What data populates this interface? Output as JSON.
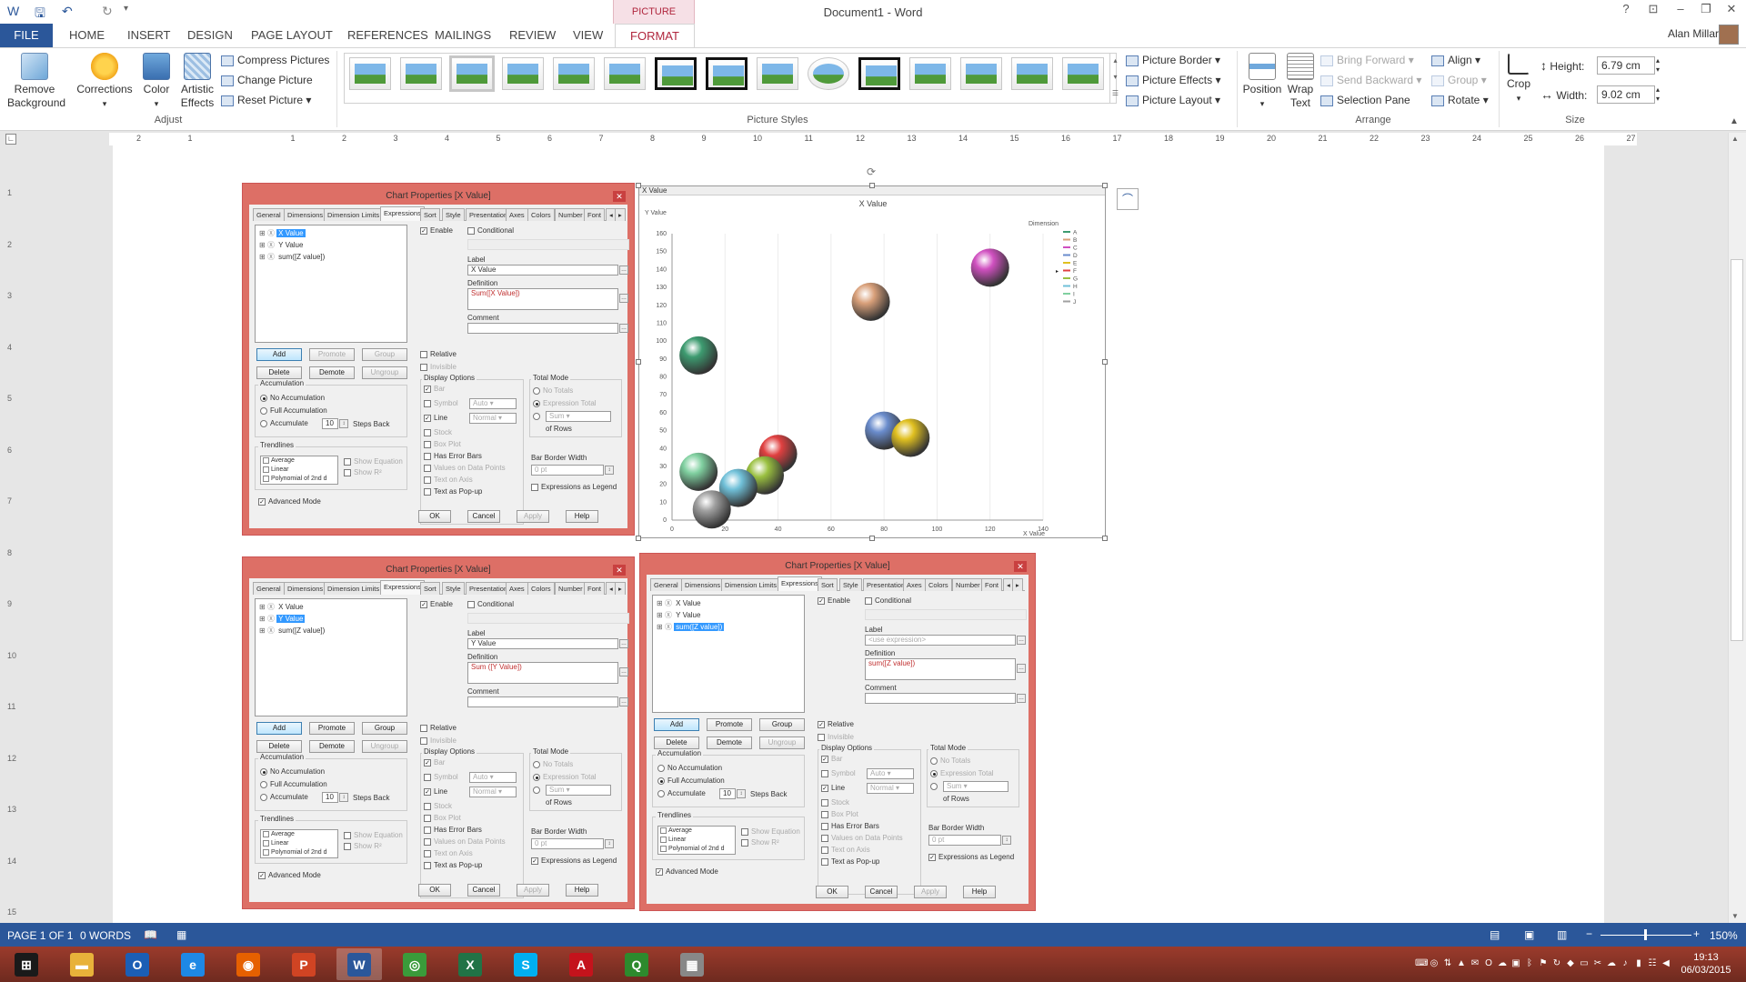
{
  "window": {
    "title": "Document1 - Word",
    "picture_tools": "PICTURE TOOLS",
    "user": "Alan Millar"
  },
  "tabs": [
    "FILE",
    "HOME",
    "INSERT",
    "DESIGN",
    "PAGE LAYOUT",
    "REFERENCES",
    "MAILINGS",
    "REVIEW",
    "VIEW",
    "FORMAT"
  ],
  "ribbon": {
    "remove_background": "Remove Background",
    "corrections": "Corrections",
    "color": "Color",
    "artistic_effects": "Artistic Effects",
    "compress_pictures": "Compress Pictures",
    "change_picture": "Change Picture",
    "reset_picture": "Reset Picture",
    "adjust_label": "Adjust",
    "picture_styles_label": "Picture Styles",
    "picture_border": "Picture Border",
    "picture_effects": "Picture Effects",
    "picture_layout": "Picture Layout",
    "position": "Position",
    "wrap_text": "Wrap Text",
    "bring_forward": "Bring Forward",
    "send_backward": "Send Backward",
    "selection_pane": "Selection Pane",
    "align": "Align",
    "group": "Group",
    "rotate": "Rotate",
    "arrange_label": "Arrange",
    "crop": "Crop",
    "height_label": "Height:",
    "height_value": "6.79 cm",
    "width_label": "Width:",
    "width_value": "9.02 cm",
    "size_label": "Size"
  },
  "ruler": {
    "numbers": [
      "2",
      "1",
      "",
      "1",
      "2",
      "3",
      "4",
      "5",
      "6",
      "7",
      "8",
      "9",
      "10",
      "11",
      "12",
      "13",
      "14",
      "15",
      "16",
      "17",
      "18",
      "19",
      "20",
      "21",
      "22",
      "23",
      "24",
      "25",
      "26",
      "27"
    ],
    "vnumbers": [
      "1",
      "2",
      "3",
      "4",
      "5",
      "6",
      "7",
      "8",
      "9",
      "10",
      "11",
      "12",
      "13",
      "14",
      "15"
    ]
  },
  "dialogs": [
    {
      "title": "Chart Properties [X Value]",
      "selected": 0,
      "label_value": "X Value",
      "definition": "Sum([X Value])",
      "label_placeholder": false,
      "promote_enabled": false,
      "relative": false,
      "accum": 0,
      "expr_legend": false
    },
    {
      "title": "Chart Properties [X Value]",
      "selected": 1,
      "label_value": "Y Value",
      "definition": "Sum ([Y Value])",
      "label_placeholder": false,
      "promote_enabled": true,
      "relative": false,
      "accum": 0,
      "expr_legend": true
    },
    {
      "title": "Chart Properties [X Value]",
      "selected": 2,
      "label_value": "<use expression>",
      "definition": "sum([Z value])",
      "label_placeholder": true,
      "promote_enabled": true,
      "relative": true,
      "accum": 1,
      "expr_legend": true
    }
  ],
  "dialog_common": {
    "tabs": [
      "General",
      "Dimensions",
      "Dimension Limits",
      "Expressions",
      "Sort",
      "Style",
      "Presentation",
      "Axes",
      "Colors",
      "Number",
      "Font"
    ],
    "active_tab": "Expressions",
    "expressions": [
      "X Value",
      "Y Value",
      "sum([Z value])"
    ],
    "btn_add": "Add",
    "btn_promote": "Promote",
    "btn_group": "Group",
    "btn_delete": "Delete",
    "btn_demote": "Demote",
    "btn_ungroup": "Ungroup",
    "enable": "Enable",
    "conditional": "Conditional",
    "label": "Label",
    "definition": "Definition",
    "comment": "Comment",
    "relative": "Relative",
    "invisible": "Invisible",
    "accumulation": "Accumulation",
    "no_accum": "No Accumulation",
    "full_accum": "Full Accumulation",
    "accumulate": "Accumulate",
    "steps": "10",
    "steps_back": "Steps Back",
    "trendlines": "Trendlines",
    "trend_items": [
      "Average",
      "Linear",
      "Polynomial of 2nd d"
    ],
    "show_equation": "Show Equation",
    "show_r2": "Show R²",
    "advanced_mode": "Advanced Mode",
    "display_options": "Display Options",
    "bar": "Bar",
    "symbol": "Symbol",
    "symbol_val": "Auto",
    "line": "Line",
    "line_val": "Normal",
    "stock": "Stock",
    "box_plot": "Box Plot",
    "has_error_bars": "Has Error Bars",
    "values_on_points": "Values on Data Points",
    "text_on_axis": "Text on Axis",
    "text_popup": "Text as Pop-up",
    "total_mode": "Total Mode",
    "no_totals": "No Totals",
    "expr_total": "Expression Total",
    "sum": "Sum",
    "of_rows": "of Rows",
    "bar_border_width": "Bar Border Width",
    "bar_border_val": "0 pt",
    "expr_legend": "Expressions as Legend",
    "ok": "OK",
    "cancel": "Cancel",
    "apply": "Apply",
    "help": "Help"
  },
  "chart_data": {
    "type": "scatter",
    "header": "X Value",
    "title": "X Value",
    "xlabel": "X Value",
    "ylabel": "Y Value",
    "xlim": [
      0,
      140
    ],
    "ylim": [
      0,
      160
    ],
    "xticks": [
      0,
      20,
      40,
      60,
      80,
      100,
      120,
      140
    ],
    "yticks": [
      0,
      10,
      20,
      30,
      40,
      50,
      60,
      70,
      80,
      90,
      100,
      110,
      120,
      130,
      140,
      150,
      160
    ],
    "legend_title": "Dimension",
    "legend_position": "top-right",
    "points": [
      {
        "name": "A",
        "x": 10,
        "y": 92,
        "size": 7,
        "color": "#3d9b70"
      },
      {
        "name": "B",
        "x": 75,
        "y": 122,
        "size": 7,
        "color": "#d9a07a"
      },
      {
        "name": "C",
        "x": 120,
        "y": 141,
        "size": 7,
        "color": "#d050c0"
      },
      {
        "name": "D",
        "x": 80,
        "y": 50,
        "size": 7,
        "color": "#6a8ccc"
      },
      {
        "name": "E",
        "x": 90,
        "y": 46,
        "size": 7,
        "color": "#e0c020"
      },
      {
        "name": "F",
        "x": 40,
        "y": 37,
        "size": 7,
        "color": "#e04040"
      },
      {
        "name": "G",
        "x": 35,
        "y": 25,
        "size": 7,
        "color": "#9ac040"
      },
      {
        "name": "H",
        "x": 25,
        "y": 18,
        "size": 7,
        "color": "#70c0d8"
      },
      {
        "name": "I",
        "x": 10,
        "y": 27,
        "size": 7,
        "color": "#80d0a0"
      },
      {
        "name": "J",
        "x": 15,
        "y": 6,
        "size": 7,
        "color": "#a0a0a0"
      }
    ]
  },
  "status": {
    "page": "PAGE 1 OF 1",
    "words": "0 WORDS",
    "zoom": "150%"
  },
  "clock": {
    "time": "19:13",
    "date": "06/03/2015"
  },
  "taskbar_apps": [
    "start",
    "explorer",
    "outlook",
    "ie",
    "firefox",
    "powerpoint",
    "word",
    "chrome",
    "excel",
    "skype",
    "acrobat",
    "qlikview",
    "app"
  ]
}
